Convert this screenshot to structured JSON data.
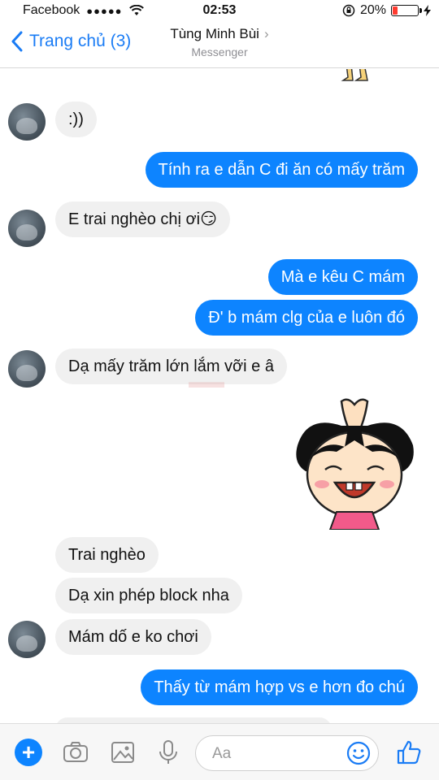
{
  "status_bar": {
    "carrier": "Facebook",
    "signal": "●●●●●",
    "time": "02:53",
    "battery_percent": "20%",
    "battery_level": 0.2
  },
  "nav": {
    "back_label": "Trang chủ (3)",
    "contact_name": "Tùng Minh Bùi",
    "chevron": "›",
    "subtitle": "Messenger"
  },
  "messages": [
    {
      "side": "in",
      "text": ":))"
    },
    {
      "side": "out",
      "text": "Tính ra e dẫn C đi ăn có mấy trăm"
    },
    {
      "side": "in",
      "text": "E trai nghèo chị ơi😏"
    },
    {
      "side": "out",
      "text": "Mà e kêu C mám"
    },
    {
      "side": "out",
      "text": "Đ' b mám clg của e luôn đó"
    },
    {
      "side": "in",
      "text": "Dạ mấy trăm lớn lắm vỡi e â"
    },
    {
      "side": "out",
      "type": "sticker",
      "icon": "praying-girl-sticker"
    },
    {
      "side": "in",
      "text": "Trai nghèo"
    },
    {
      "side": "in",
      "text": "Dạ xin phép block nha"
    },
    {
      "side": "in",
      "text": "Mám dố e ko chơi"
    },
    {
      "side": "out",
      "text": "Thấy từ mám hợp vs e hơn đo chú"
    }
  ],
  "composer": {
    "placeholder": "Aa",
    "icons": [
      "plus-icon",
      "camera-icon",
      "image-icon",
      "microphone-icon",
      "emoji-icon",
      "thumbs-up-icon"
    ]
  },
  "colors": {
    "accent": "#0d84ff",
    "incoming_bubble": "#f0f0f0",
    "battery_low": "#ff3b30"
  }
}
